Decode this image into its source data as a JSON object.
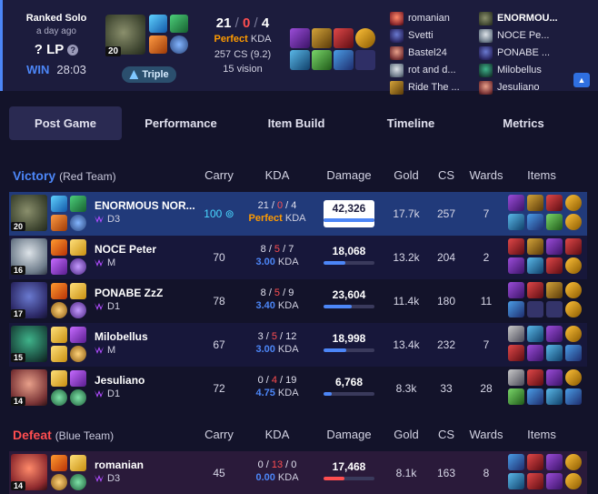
{
  "header": {
    "queue": "Ranked Solo",
    "ago": "a day ago",
    "lp": "? LP",
    "help_icon": "?",
    "result": "WIN",
    "duration": "28:03",
    "champion_level": "20",
    "tag": "Triple",
    "kills": "21",
    "deaths": "0",
    "assists": "4",
    "slash": "/",
    "perfect_word": "Perfect",
    "kda_word": "KDA",
    "cs": "257 CS (9.2)",
    "vision": "15 vision",
    "expand_icon": "chevron-up-icon"
  },
  "header_teams": {
    "red": [
      "romanian",
      "Svetti",
      "Bastel24",
      "rot and d...",
      "Ride The ..."
    ],
    "blue": [
      "ENORMOU...",
      "NOCE Pe...",
      "PONABE ...",
      "Milobellus",
      "Jesuliano"
    ]
  },
  "tabs": [
    {
      "label": "Post Game",
      "active": true
    },
    {
      "label": "Performance",
      "active": false
    },
    {
      "label": "Item Build",
      "active": false
    },
    {
      "label": "Timeline",
      "active": false
    },
    {
      "label": "Metrics",
      "active": false
    }
  ],
  "columns": {
    "carry": "Carry",
    "kda": "KDA",
    "damage": "Damage",
    "gold": "Gold",
    "cs": "CS",
    "wards": "Wards",
    "items": "Items"
  },
  "victory_team": {
    "result": "Victory",
    "label": "(Red Team)",
    "players": [
      {
        "name": "ENORMOUS NOR...",
        "level": "20",
        "rank": "D3",
        "carry": "100 ⊚",
        "k": "21",
        "d": "0",
        "a": "4",
        "kda": "Perfect",
        "kda_suffix": "KDA",
        "damage": "42,326",
        "damage_pct": 100,
        "gold": "17.7k",
        "cs": "257",
        "wards": "7"
      },
      {
        "name": "NOCE Peter",
        "level": "16",
        "rank": "M",
        "carry": "70",
        "k": "8",
        "d": "5",
        "a": "7",
        "kda": "3.00",
        "kda_suffix": "KDA",
        "damage": "18,068",
        "damage_pct": 43,
        "gold": "13.2k",
        "cs": "204",
        "wards": "2"
      },
      {
        "name": "PONABE ZzZ",
        "level": "17",
        "rank": "D1",
        "carry": "78",
        "k": "8",
        "d": "5",
        "a": "9",
        "kda": "3.40",
        "kda_suffix": "KDA",
        "damage": "23,604",
        "damage_pct": 56,
        "gold": "11.4k",
        "cs": "180",
        "wards": "11"
      },
      {
        "name": "Milobellus",
        "level": "15",
        "rank": "M",
        "carry": "67",
        "k": "3",
        "d": "5",
        "a": "12",
        "kda": "3.00",
        "kda_suffix": "KDA",
        "damage": "18,998",
        "damage_pct": 45,
        "gold": "13.4k",
        "cs": "232",
        "wards": "7"
      },
      {
        "name": "Jesuliano",
        "level": "14",
        "rank": "D1",
        "carry": "72",
        "k": "0",
        "d": "4",
        "a": "19",
        "kda": "4.75",
        "kda_suffix": "KDA",
        "damage": "6,768",
        "damage_pct": 16,
        "gold": "8.3k",
        "cs": "33",
        "wards": "28"
      }
    ]
  },
  "defeat_team": {
    "result": "Defeat",
    "label": "(Blue Team)",
    "players": [
      {
        "name": "romanian",
        "level": "14",
        "rank": "D3",
        "carry": "45",
        "k": "0",
        "d": "13",
        "a": "0",
        "kda": "0.00",
        "kda_suffix": "KDA",
        "damage": "17,468",
        "damage_pct": 41,
        "gold": "8.1k",
        "cs": "163",
        "wards": "8"
      }
    ]
  }
}
